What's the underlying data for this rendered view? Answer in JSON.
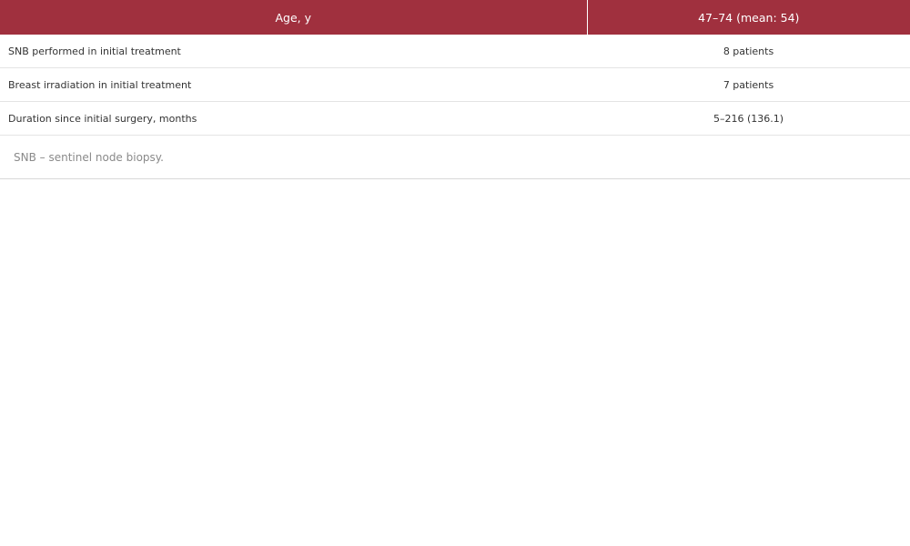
{
  "colors": {
    "header_bg": "#a0303e",
    "header_text": "#ffffff",
    "body_text": "#333333",
    "footnote_text": "#8a8a8a",
    "row_divider": "#e4e4e4"
  },
  "table": {
    "header": {
      "label": "Age, y",
      "value": "47–74 (mean: 54)"
    },
    "rows": [
      {
        "label": "SNB performed in initial treatment",
        "value": "8 patients"
      },
      {
        "label": "Breast irradiation in initial treatment",
        "value": "7 patients"
      },
      {
        "label": "Duration since initial surgery, months",
        "value": "5–216 (136.1)"
      }
    ]
  },
  "footnote": "SNB – sentinel node biopsy."
}
